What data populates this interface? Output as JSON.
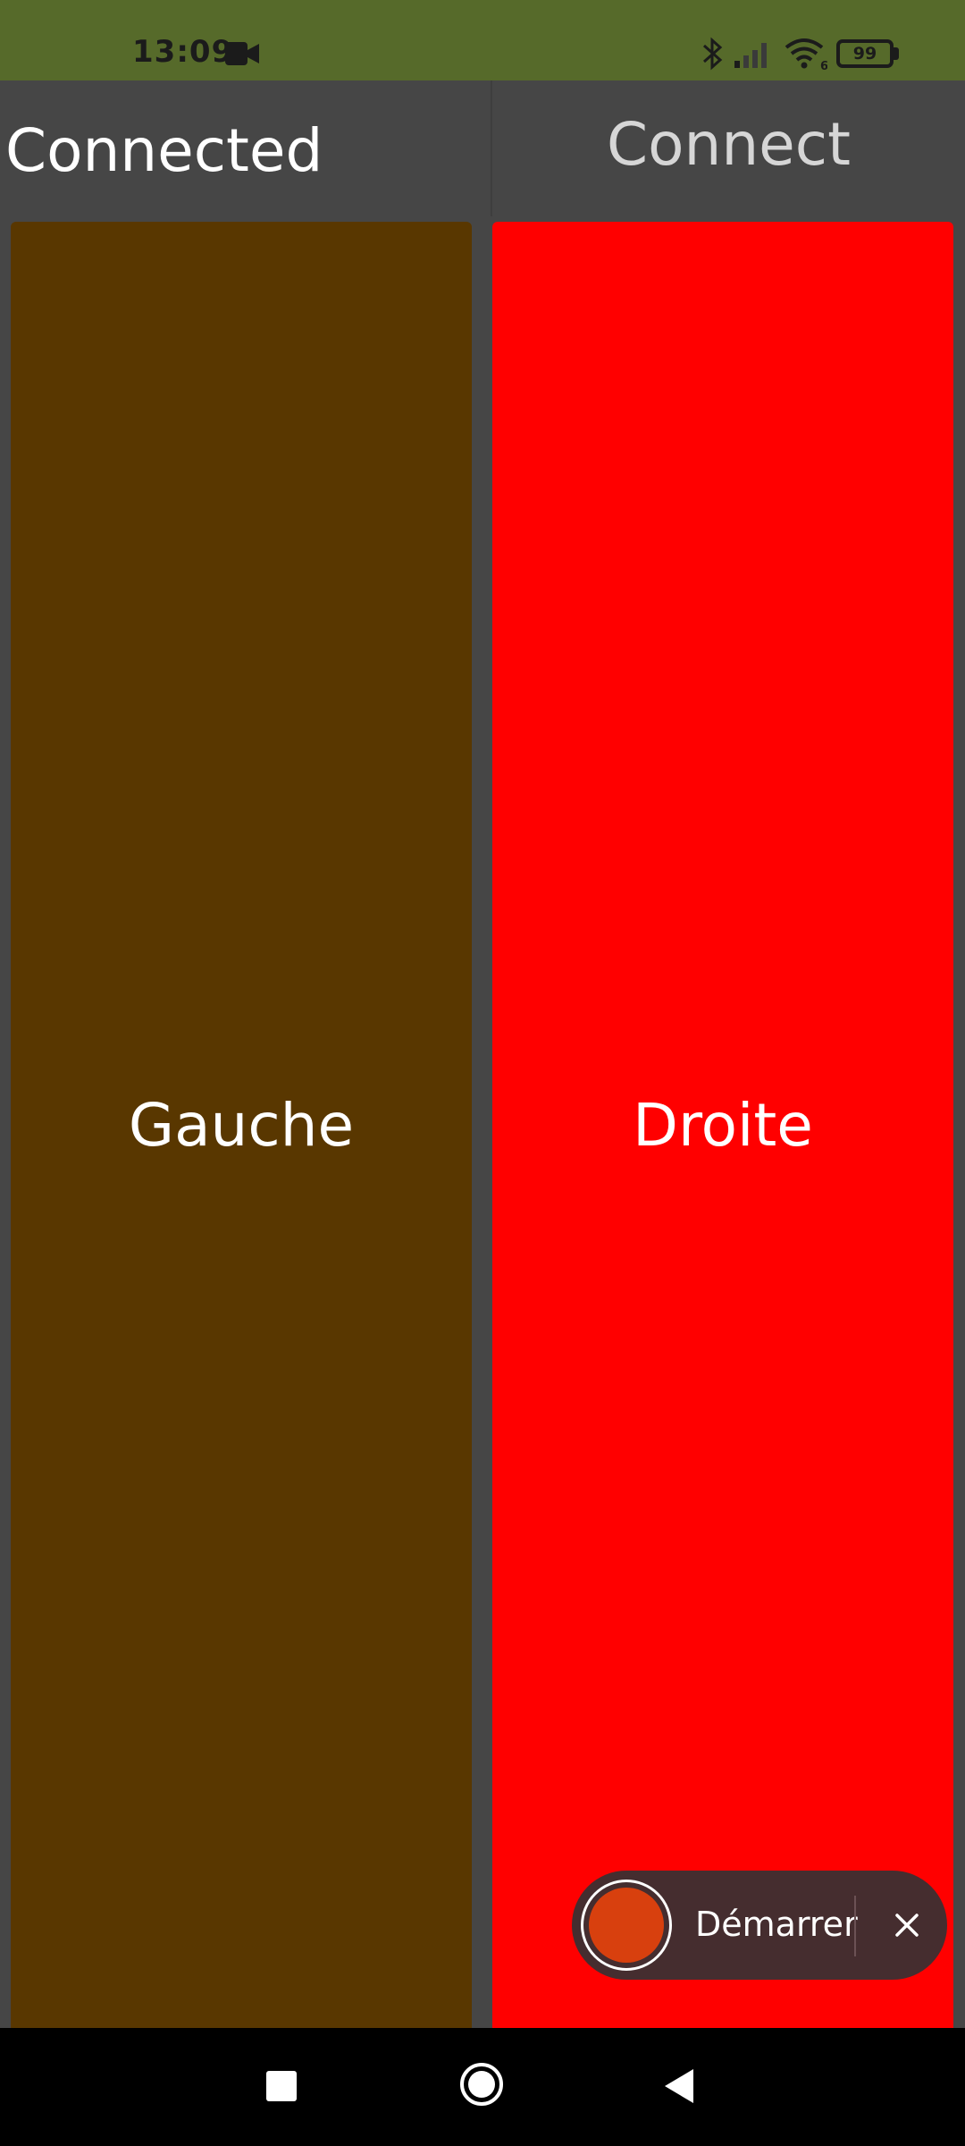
{
  "status_bar": {
    "time": "13:09",
    "battery": "99",
    "background_color": "#566a2a",
    "icons": [
      "camera-icon",
      "bluetooth-icon",
      "signal-icon",
      "wifi-icon",
      "battery-icon"
    ]
  },
  "header": {
    "status_text": "Connected",
    "connect_label": "Connect"
  },
  "panels": {
    "left": {
      "label": "Gauche",
      "color": "#593700"
    },
    "right": {
      "label": "Droite",
      "color": "#ff0000"
    }
  },
  "recorder": {
    "start_label": "Démarrer",
    "close_icon": "close-icon",
    "record_color": "#d8400e"
  },
  "nav_bar": {
    "buttons": [
      "recents-icon",
      "home-icon",
      "back-icon"
    ]
  }
}
